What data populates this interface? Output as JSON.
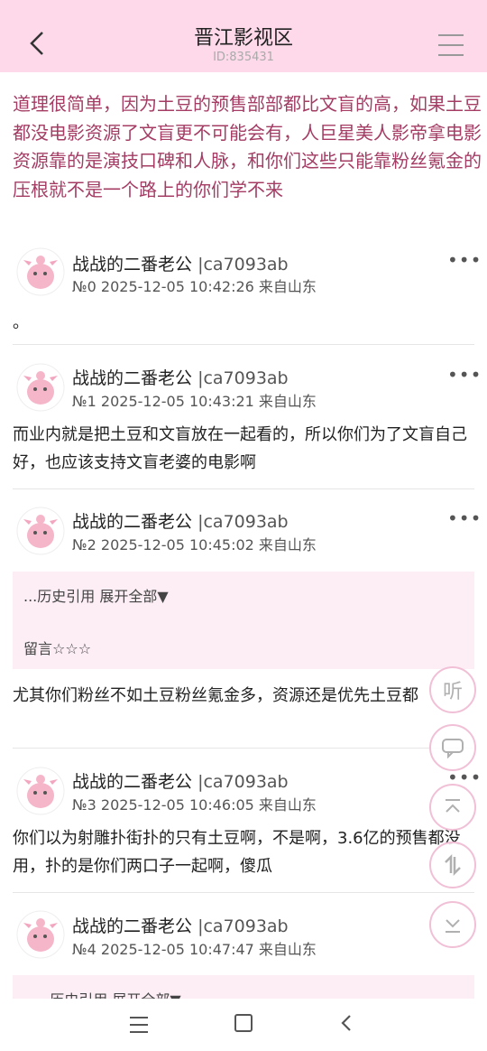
{
  "header": {
    "title": "晋江影视区",
    "id": "ID:835431"
  },
  "lead_text": "道理很简单，因为土豆的预售部部都比文盲的高，如果土豆都没电影资源了文盲更不可能会有，人巨星美人影帝拿电影资源靠的是演技口碑和人脉，和你们这些只能靠粉丝氪金的压根就不是一个路上的你们学不来",
  "posts": [
    {
      "name": "战战的二番老公",
      "uid": "|ca7093ab",
      "meta": "№0 2025-12-05 10:42:26 来自山东",
      "text": "。"
    },
    {
      "name": "战战的二番老公",
      "uid": "|ca7093ab",
      "meta": "№1 2025-12-05 10:43:21 来自山东",
      "text": "而业内就是把土豆和文盲放在一起看的，所以你们为了文盲自己好，也应该支持文盲老婆的电影啊"
    },
    {
      "name": "战战的二番老公",
      "uid": "|ca7093ab",
      "meta": "№2 2025-12-05 10:45:02 来自山东",
      "quote_history": "...历史引用 展开全部▼",
      "quote_msg": "留言☆☆☆",
      "text": "尤其你们粉丝不如土豆粉丝氪金多，资源还是优先土豆都"
    },
    {
      "name": "战战的二番老公",
      "uid": "|ca7093ab",
      "meta": "№3 2025-12-05 10:46:05 来自山东",
      "text": "你们以为射雕扑街扑的只有土豆啊，不是啊，3.6亿的预售都没用，扑的是你们两口子一起啊，傻瓜"
    },
    {
      "name": "战战的二番老公",
      "uid": "|ca7093ab",
      "meta": "№4 2025-12-05 10:47:47 来自山东",
      "quote_history": "...历史引用 展开全部▼"
    }
  ],
  "more_glyph": "•••",
  "fab": {
    "listen": "听"
  },
  "colors": {
    "header_bg": "#fdd9ea",
    "accent_text": "#a43c64",
    "quote_bg": "#fdeef5",
    "fab_border": "#f1c0d6"
  },
  "icons": [
    "back-arrow-icon",
    "hamburger-menu-icon",
    "more-dots-icon",
    "avatar-pink-creature-icon",
    "comment-icon",
    "scroll-top-icon",
    "swap-icon",
    "scroll-bottom-icon",
    "nav-recent-icon",
    "nav-home-icon",
    "nav-back-icon"
  ]
}
